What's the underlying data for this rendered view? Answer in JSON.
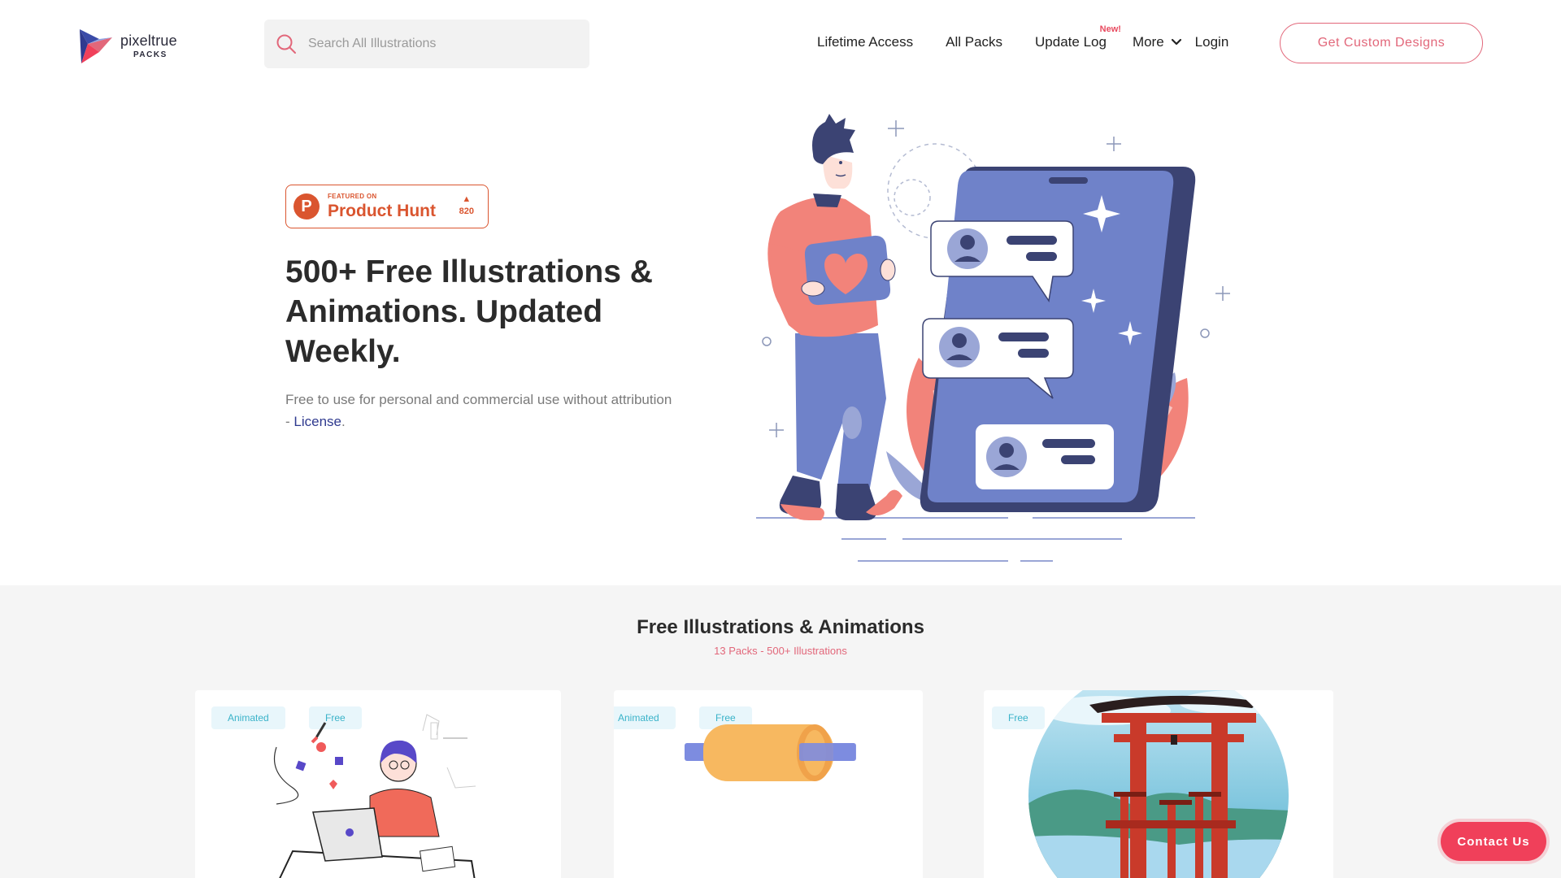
{
  "brand": {
    "name": "pixeltrue",
    "sub": "PACKS"
  },
  "search": {
    "placeholder": "Search All Illustrations"
  },
  "nav": {
    "lifetime": "Lifetime Access",
    "all_packs": "All Packs",
    "update_log": "Update Log",
    "update_badge": "New!",
    "more": "More",
    "login": "Login"
  },
  "cta": {
    "label": "Get Custom Designs"
  },
  "product_hunt": {
    "featured": "FEATURED ON",
    "name": "Product Hunt",
    "votes": "820"
  },
  "hero": {
    "title": "500+ Free Illustrations & Animations. Updated Weekly.",
    "subtitle_prefix": "Free to use for personal and commercial use without attribution - ",
    "license_link": "License",
    "subtitle_suffix": "."
  },
  "section": {
    "title": "Free Illustrations & Animations",
    "subtitle": "13 Packs - 500+ Illustrations"
  },
  "cards": [
    {
      "tags": [
        "Animated",
        "Free"
      ]
    },
    {
      "tags": [
        "Animated",
        "Free"
      ]
    },
    {
      "tags": [
        "Free"
      ]
    }
  ],
  "contact": {
    "label": "Contact Us"
  },
  "colors": {
    "accent": "#e2677a",
    "contact_bg": "#f0405a",
    "product_hunt": "#da552f",
    "link": "#2f3a8f",
    "tag_text": "#3ab3c9",
    "tag_bg": "#e8f6fb",
    "illus_blue": "#6f82c9",
    "illus_salmon": "#f2837a",
    "illus_navy": "#3b4373"
  }
}
